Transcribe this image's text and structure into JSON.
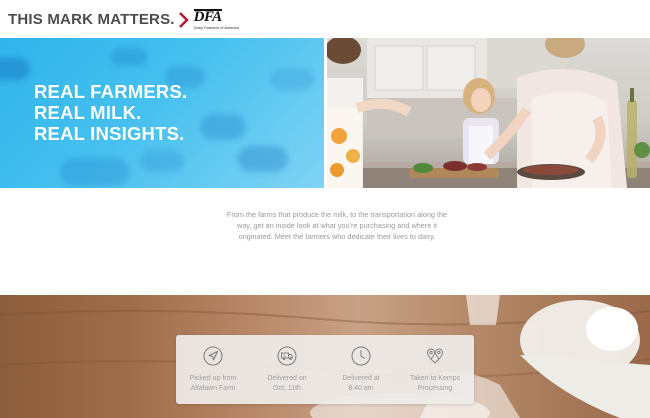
{
  "header": {
    "tagline": "THIS MARK MATTERS.",
    "logo_text": "DFA",
    "logo_subtext": "Dairy Farmers of America"
  },
  "hero": {
    "headline_lines": [
      "REAL FARMERS.",
      "REAL MILK.",
      "REAL INSIGHTS."
    ],
    "image_description_icon": "family-cooking-photo"
  },
  "intro": {
    "text": "From the farms that produce the milk, to the transportation along the way, get an inside look at what you're purchasing and where it originated. Meet the farmers who dedicate their lives to dairy."
  },
  "tracker": {
    "steps": [
      {
        "icon": "navigation-arrow-icon",
        "label_line1": "Picked up from",
        "label_line2": "Alfalawn Farm"
      },
      {
        "icon": "delivery-truck-icon",
        "label_line1": "Delivered on",
        "label_line2": "Oct. 11th"
      },
      {
        "icon": "clock-icon",
        "label_line1": "Delivered at",
        "label_line2": "8:40 am"
      },
      {
        "icon": "map-pins-icon",
        "label_line1": "Taken to Kemps",
        "label_line2": "Processing"
      }
    ]
  },
  "colors": {
    "accent_red": "#b01c2e",
    "tagline_gray": "#4d4d4d",
    "hero_blue": "#3db9ec",
    "muted_text": "#9a9a9a"
  }
}
